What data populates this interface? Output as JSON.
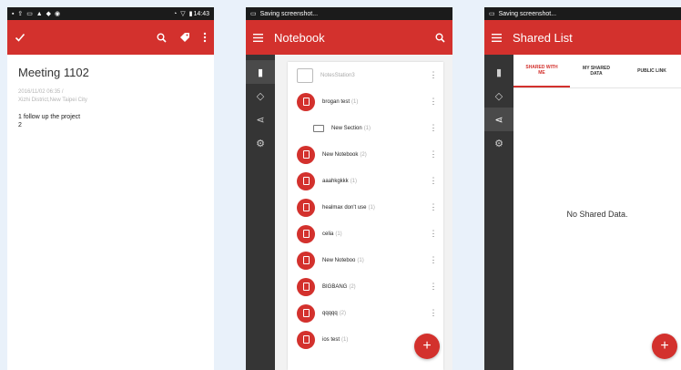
{
  "phone1": {
    "status": {
      "time": "14:43"
    },
    "note": {
      "title": "Meeting 1102",
      "meta_line1": "2016/11/02 06:35 /",
      "meta_line2": "Xizhi District,New Taipei City",
      "body_line1": "1 follow up the project",
      "body_line2": "2"
    }
  },
  "phone2": {
    "status": {
      "text": "Saving screenshot..."
    },
    "title": "Notebook",
    "station": "NotesStation3",
    "items": [
      {
        "label": "brogan test",
        "count": "(1)",
        "kind": "notebook"
      },
      {
        "label": "New Section",
        "count": "(1)",
        "kind": "section"
      },
      {
        "label": "New Notebook",
        "count": "(2)",
        "kind": "notebook"
      },
      {
        "label": "aaahkgkkk",
        "count": "(1)",
        "kind": "notebook"
      },
      {
        "label": "healmax don't use",
        "count": "(1)",
        "kind": "notebook"
      },
      {
        "label": "celia",
        "count": "(1)",
        "kind": "notebook"
      },
      {
        "label": "New Noteboo",
        "count": "(1)",
        "kind": "notebook"
      },
      {
        "label": "BIGBANG",
        "count": "(2)",
        "kind": "notebook"
      },
      {
        "label": "qqqqq",
        "count": "(2)",
        "kind": "notebook"
      },
      {
        "label": "ios test",
        "count": "(1)",
        "kind": "notebook"
      }
    ],
    "fab": "+"
  },
  "phone3": {
    "status": {
      "text": "Saving screenshot..."
    },
    "title": "Shared List",
    "tabs": [
      "SHARED WITH\nME",
      "MY SHARED\nDATA",
      "PUBLIC LINK"
    ],
    "empty": "No Shared Data.",
    "fab": "+"
  },
  "colors": {
    "accent": "#d3312d",
    "rail": "#353535",
    "statusbar": "#1b1b1b"
  },
  "icons": [
    "check-icon",
    "search-icon",
    "tag-icon",
    "more-vert-icon",
    "menu-icon",
    "notebook-icon",
    "share-icon",
    "settings-icon",
    "folder-icon",
    "plus-icon"
  ]
}
